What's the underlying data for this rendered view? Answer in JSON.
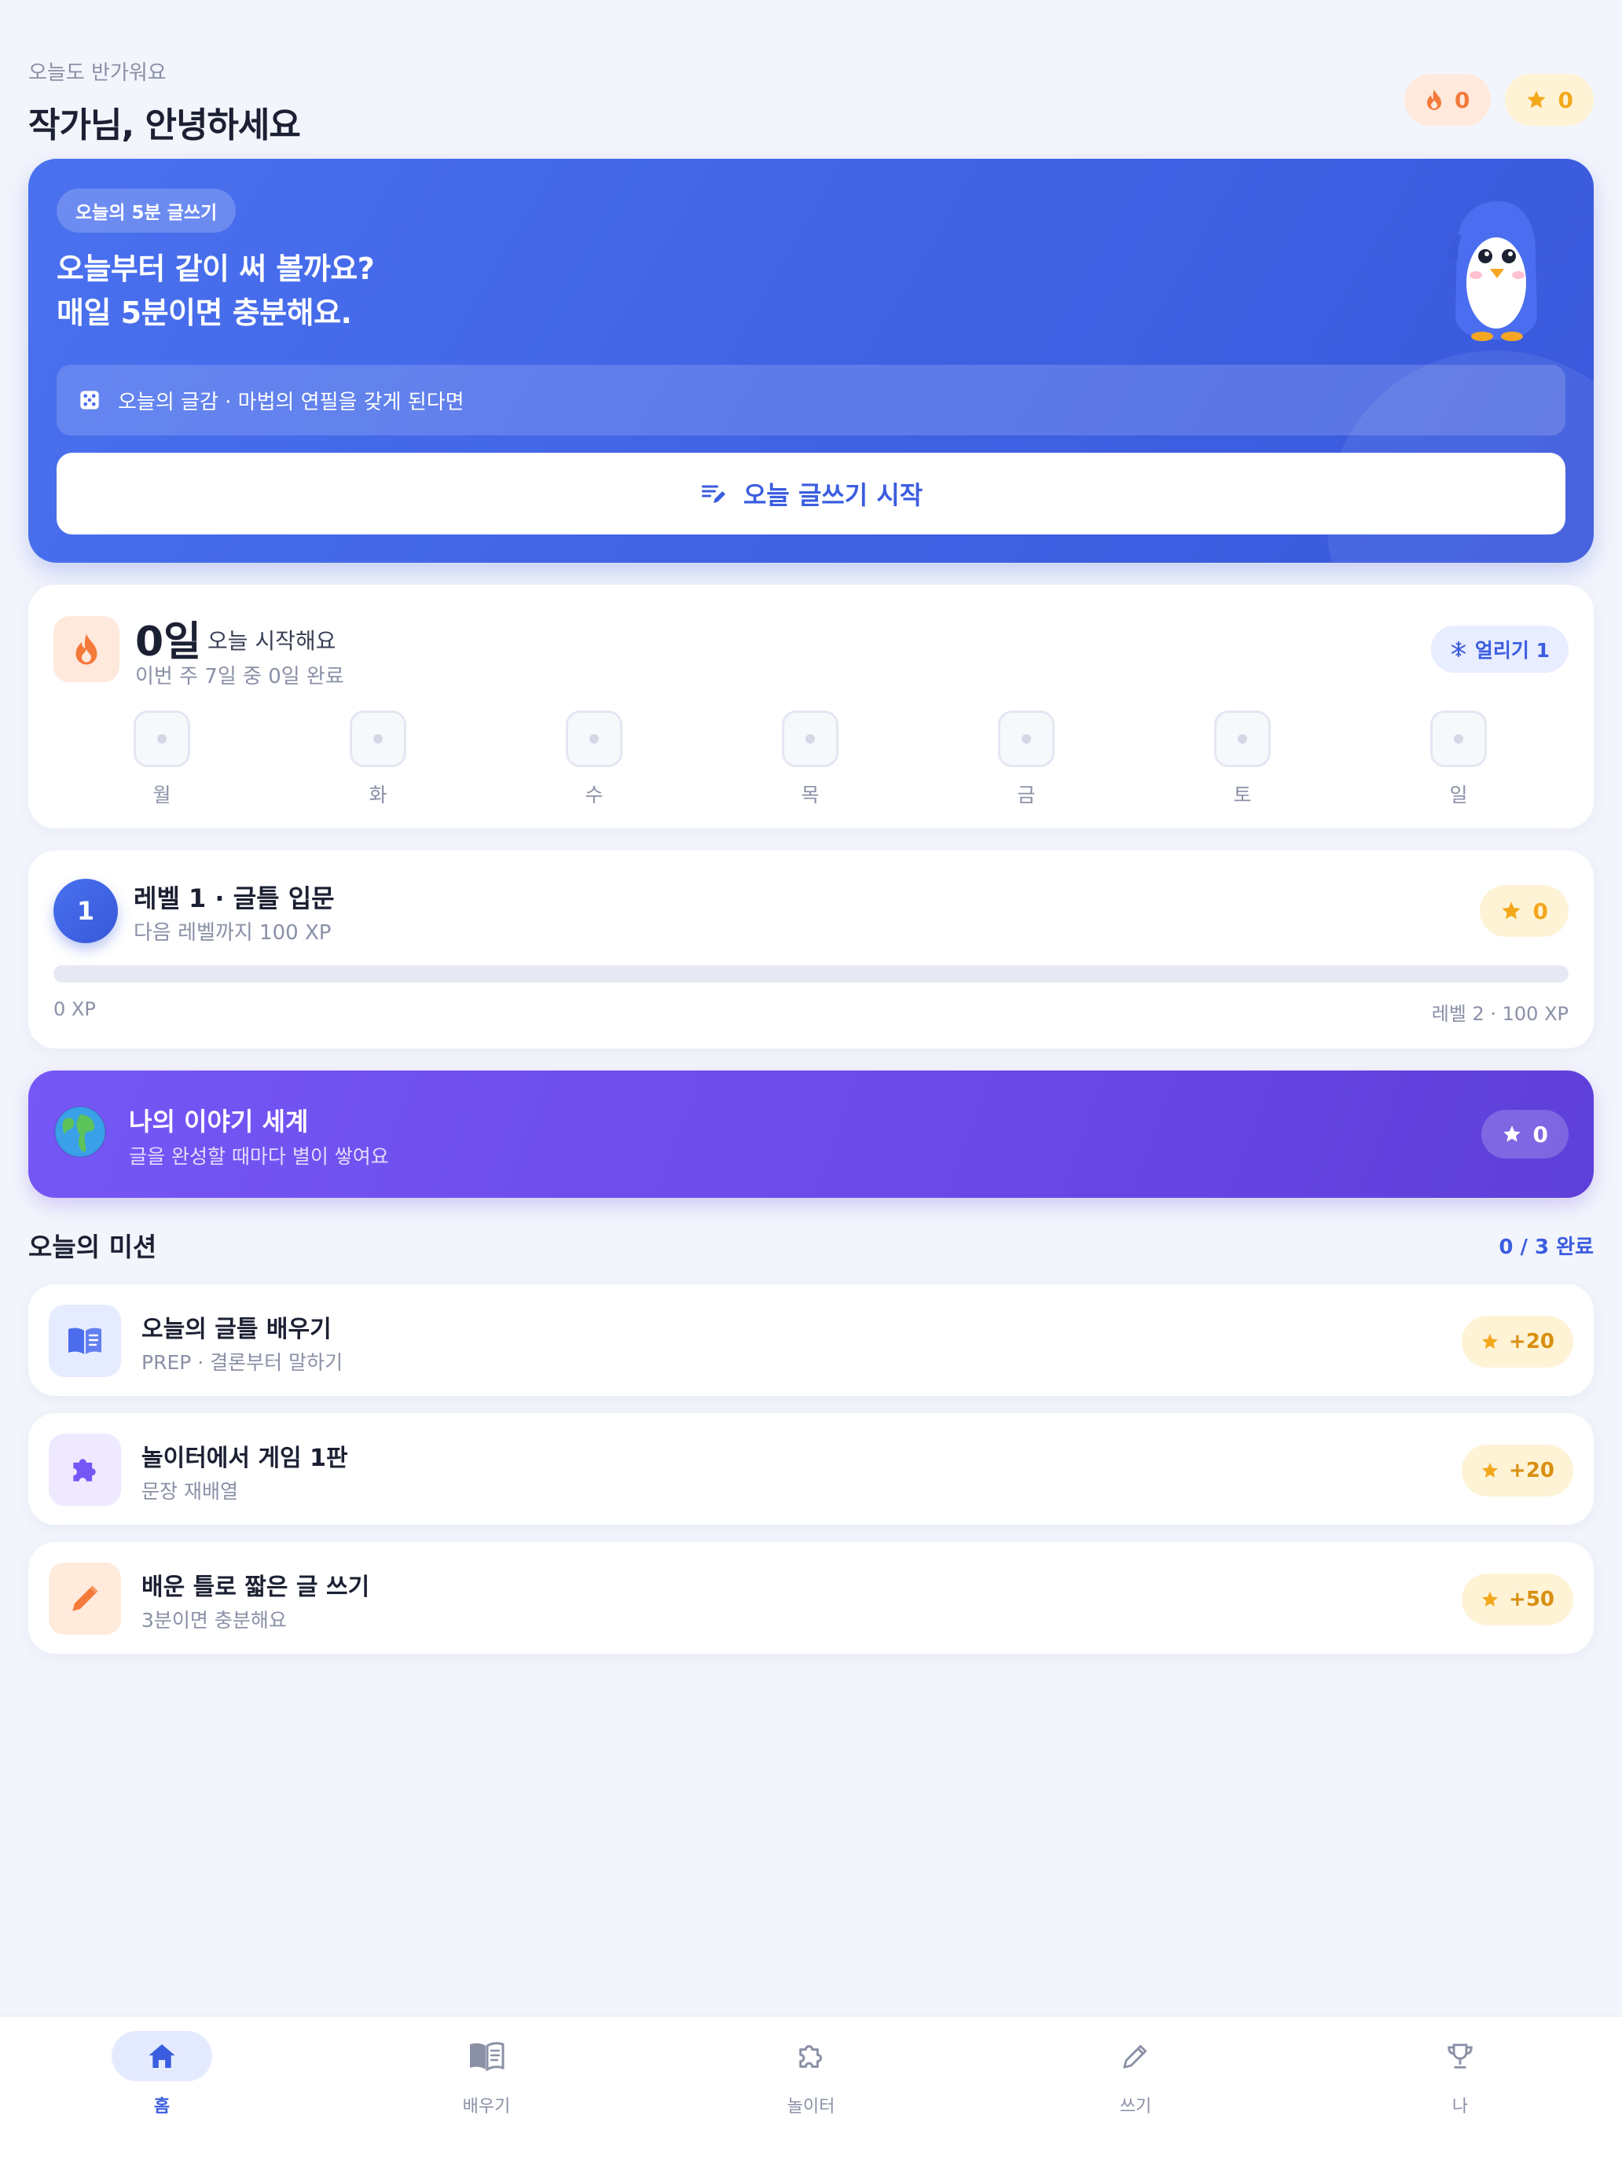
{
  "header": {
    "greeting_sub": "오늘도 반가워요",
    "greeting_title": "작가님, 안녕하세요",
    "streak_pill": "0",
    "star_pill": "0"
  },
  "hero": {
    "badge": "오늘의 5분 글쓰기",
    "title_line1": "오늘부터 같이 써 볼까요?",
    "title_line2": "매일 5분이면 충분해요.",
    "topic": "오늘의 글감 · 마법의 연필을 갖게 된다면",
    "button": "오늘 글쓰기 시작"
  },
  "streak": {
    "count": "0일",
    "today": "오늘 시작해요",
    "week": "이번 주 7일 중 0일 완료",
    "freeze": "얼리기 1",
    "days": [
      "월",
      "화",
      "수",
      "목",
      "금",
      "토",
      "일"
    ]
  },
  "level": {
    "number": "1",
    "title": "레벨 1 · 글틀 입문",
    "sub": "다음 레벨까지 100 XP",
    "stars": "0",
    "progress": 0,
    "left_label": "0 XP",
    "right_label": "레벨 2 · 100 XP"
  },
  "world": {
    "title": "나의 이야기 세계",
    "sub": "글을 완성할 때마다 별이 쌓여요",
    "stars": "0"
  },
  "missions": {
    "title": "오늘의 미션",
    "count": "0 / 3 완료",
    "items": [
      {
        "title": "오늘의 글틀 배우기",
        "sub": "PREP · 결론부터 말하기",
        "xp": "+20",
        "icon": "book-icon",
        "color": "#e6ecff"
      },
      {
        "title": "놀이터에서 게임 1판",
        "sub": "문장 재배열",
        "xp": "+20",
        "icon": "puzzle-icon",
        "color": "#efe9ff"
      },
      {
        "title": "배운 틀로 짧은 글 쓰기",
        "sub": "3분이면 충분해요",
        "xp": "+50",
        "icon": "pencil-icon",
        "color": "#ffeadc"
      }
    ]
  },
  "nav": {
    "items": [
      {
        "label": "홈",
        "icon": "home-icon",
        "active": true
      },
      {
        "label": "배우기",
        "icon": "book-icon",
        "active": false
      },
      {
        "label": "놀이터",
        "icon": "puzzle-icon",
        "active": false
      },
      {
        "label": "쓰기",
        "icon": "pencil-icon",
        "active": false
      },
      {
        "label": "나",
        "icon": "trophy-icon",
        "active": false
      }
    ]
  },
  "colors": {
    "accent": "#3b5de0",
    "orange": "#f47a3a",
    "star": "#f3a81c",
    "purple": "#6a4ae9"
  }
}
